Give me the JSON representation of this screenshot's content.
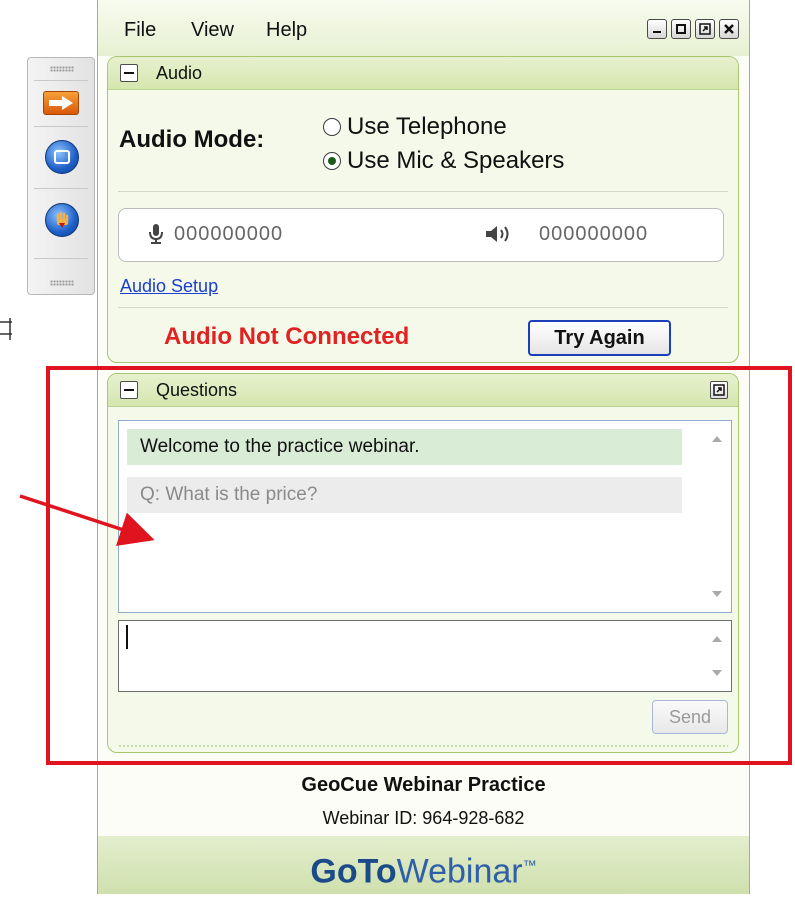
{
  "side_toolbar": {
    "icons": [
      "arrow-right-icon",
      "screen-icon",
      "raise-hand-icon"
    ]
  },
  "menu": {
    "file": "File",
    "view": "View",
    "help": "Help"
  },
  "window_controls": [
    "minimize-icon",
    "maximize-icon",
    "restore-icon",
    "close-icon"
  ],
  "audio": {
    "panel_title": "Audio",
    "mode_label": "Audio Mode:",
    "option_telephone": "Use Telephone",
    "option_mic": "Use Mic & Speakers",
    "selected": "Use Mic & Speakers",
    "mic_level": "000000000",
    "speaker_level": "000000000",
    "setup_link": "Audio Setup",
    "status": "Audio Not Connected",
    "try_again": "Try Again"
  },
  "questions": {
    "panel_title": "Questions",
    "messages": [
      "Welcome to the practice webinar.",
      "Q: What is the price?"
    ],
    "input_value": "",
    "send": "Send"
  },
  "footer": {
    "webinar_name": "GeoCue Webinar Practice",
    "webinar_id": "Webinar ID: 964-928-682",
    "brand_go": "Go",
    "brand_to": "To",
    "brand_webinar": "Webinar",
    "brand_tm": "™"
  },
  "colors": {
    "panel_border": "#a9c76c",
    "status_red": "#e12222",
    "annotation_red": "#e0141e",
    "link_blue": "#1a3fcf"
  }
}
